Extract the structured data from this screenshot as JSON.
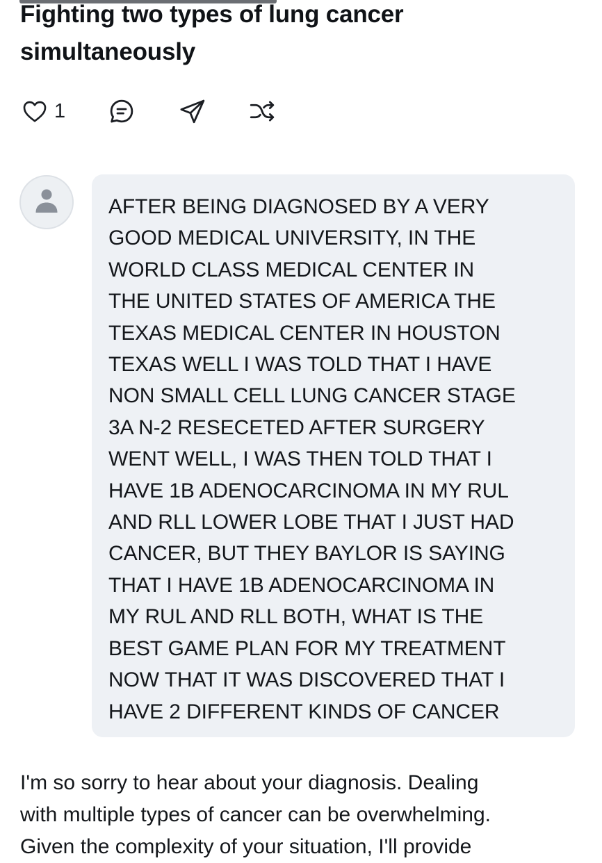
{
  "post": {
    "title": "Fighting two types of lung cancer\nsimultaneously",
    "like_count": "1"
  },
  "icons": {
    "like": "heart-icon",
    "comment": "comment-icon",
    "share": "send-icon",
    "remix": "shuffle-icon",
    "avatar": "user-icon"
  },
  "colors": {
    "bubble_background": "#eef1f5",
    "avatar_background": "#edf0f3",
    "avatar_figure": "#8a9099",
    "text": "#14171b"
  },
  "message": {
    "text": "AFTER BEING DIAGNOSED BY A VERY\nGOOD MEDICAL UNIVERSITY, IN THE\nWORLD CLASS MEDICAL CENTER IN\nTHE UNITED STATES OF AMERICA THE\nTEXAS MEDICAL CENTER IN HOUSTON\nTEXAS WELL I WAS TOLD THAT I HAVE\nNON SMALL CELL LUNG CANCER STAGE\n3A N-2 RESECETED AFTER SURGERY\nWENT WELL, I WAS THEN TOLD THAT I\nHAVE 1B ADENOCARCINOMA IN MY RUL\nAND RLL LOWER LOBE THAT I JUST HAD\nCANCER, BUT THEY BAYLOR IS SAYING\nTHAT I HAVE 1B ADENOCARCINOMA IN\nMY RUL AND RLL BOTH, WHAT IS THE\nBEST GAME PLAN FOR MY TREATMENT\nNOW THAT IT WAS DISCOVERED THAT I\nHAVE 2 DIFFERENT KINDS OF CANCER"
  },
  "response": {
    "text": "I'm so sorry to hear about your diagnosis. Dealing\nwith multiple types of cancer can be overwhelming.\nGiven the complexity of your situation, I'll provide"
  }
}
